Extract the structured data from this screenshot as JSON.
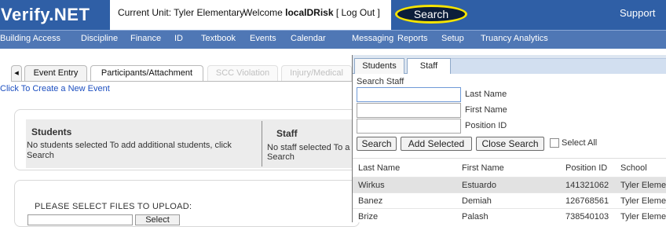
{
  "app": {
    "logo": "Verify.NET",
    "current_unit": "Current Unit: Tyler Elementary",
    "welcome_prefix": "Welcome ",
    "username": "localDRisk",
    "logout": "[ Log Out ]",
    "search": "Search",
    "support": "Support"
  },
  "nav": [
    "Building Access",
    "Discipline",
    "Finance",
    "ID",
    "Textbook",
    "Events",
    "Calendar",
    "Messaging",
    "Reports",
    "Setup",
    "Truancy Analytics"
  ],
  "tabs": {
    "arrow": "◂",
    "items": [
      "Event Entry",
      "Participants/Attachment",
      "SCC Violation",
      "Injury/Medical"
    ]
  },
  "create_link": "Click To Create a New Event",
  "panels": {
    "students_title": "Students",
    "students_text_1": "No students selected To add additional students, click",
    "students_text_2": "Search",
    "staff_title": "Staff",
    "staff_text_1": "No staff selected To a",
    "staff_text_2": "Search"
  },
  "upload": {
    "label": "PLEASE SELECT FILES TO UPLOAD:",
    "select": "Select"
  },
  "popup": {
    "tabs": [
      "Students",
      "Staff"
    ],
    "legend": "Search Staff",
    "fields": {
      "last_name": "Last Name",
      "first_name": "First Name",
      "position_id": "Position ID"
    },
    "buttons": {
      "search": "Search",
      "add_selected": "Add Selected",
      "close_search": "Close Search",
      "select_all": "Select All"
    },
    "table": {
      "headers": [
        "Last Name",
        "First Name",
        "Position ID",
        "School"
      ],
      "rows": [
        [
          "Wirkus",
          "Estuardo",
          "141321062",
          "Tyler Elemer"
        ],
        [
          "Banez",
          "Demiah",
          "126768561",
          "Tyler Elemer"
        ],
        [
          "Brize",
          "Palash",
          "738540103",
          "Tyler Elemer"
        ]
      ]
    }
  }
}
